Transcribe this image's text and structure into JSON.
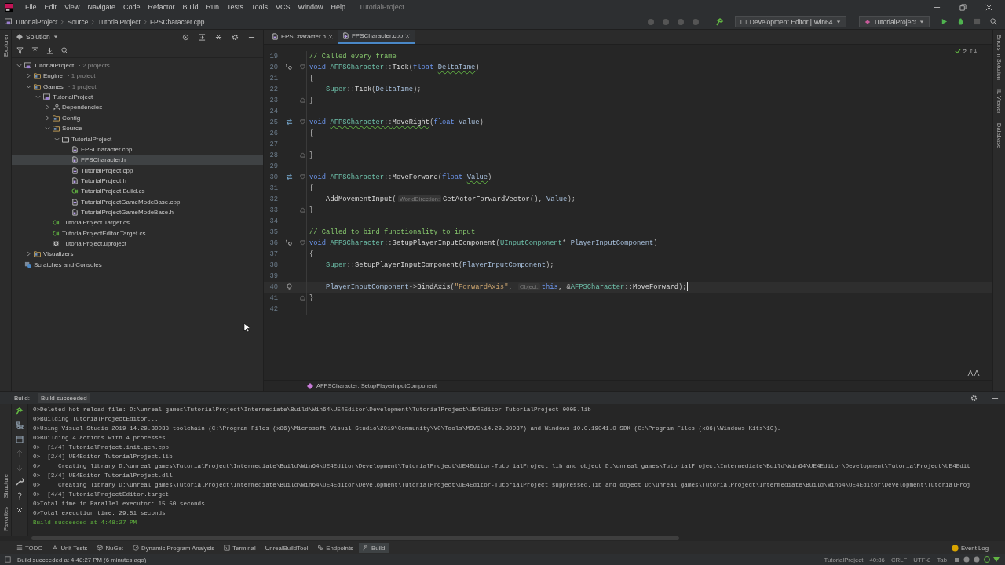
{
  "menu": {
    "items": [
      "File",
      "Edit",
      "View",
      "Navigate",
      "Code",
      "Refactor",
      "Build",
      "Run",
      "Tests",
      "Tools",
      "VCS",
      "Window",
      "Help"
    ],
    "title": "TutorialProject"
  },
  "breadcrumbs": [
    "TutorialProject",
    "Source",
    "TutorialProject",
    "FPSCharacter.cpp"
  ],
  "toolbar": {
    "configuration": "Development Editor | Win64",
    "run_target": "TutorialProject"
  },
  "left_strip": {
    "top_label": "Explorer",
    "bottom_labels": [
      "Structure",
      "Favorites"
    ]
  },
  "right_strip": {
    "labels": [
      "Errors In Solution",
      "IL Viewer",
      "Database"
    ]
  },
  "solution": {
    "header": "Solution",
    "tree": [
      {
        "label": "TutorialProject",
        "note": "· 2 projects",
        "kind": "solution",
        "expanded": true,
        "selected": false,
        "children": [
          {
            "label": "Engine",
            "note": "· 1 project",
            "kind": "ue-folder",
            "expanded": false,
            "selected": false
          },
          {
            "label": "Games",
            "note": "· 1 project",
            "kind": "ue-folder",
            "expanded": true,
            "selected": false,
            "children": [
              {
                "label": "TutorialProject",
                "kind": "project",
                "expanded": true,
                "selected": false,
                "children": [
                  {
                    "label": "Dependencies",
                    "kind": "deps",
                    "expanded": false,
                    "selected": false
                  },
                  {
                    "label": "Config",
                    "kind": "ue-folder",
                    "expanded": false,
                    "selected": false
                  },
                  {
                    "label": "Source",
                    "kind": "ue-folder",
                    "expanded": true,
                    "selected": false,
                    "children": [
                      {
                        "label": "TutorialProject",
                        "kind": "folder",
                        "expanded": true,
                        "selected": false,
                        "children": [
                          {
                            "label": "FPSCharacter.cpp",
                            "kind": "cpp",
                            "selected": false
                          },
                          {
                            "label": "FPSCharacter.h",
                            "kind": "h",
                            "selected": true
                          },
                          {
                            "label": "TutorialProject.cpp",
                            "kind": "cpp",
                            "selected": false
                          },
                          {
                            "label": "TutorialProject.h",
                            "kind": "h",
                            "selected": false
                          },
                          {
                            "label": "TutorialProject.Build.cs",
                            "kind": "cs",
                            "selected": false
                          },
                          {
                            "label": "TutorialProjectGameModeBase.cpp",
                            "kind": "cpp",
                            "selected": false
                          },
                          {
                            "label": "TutorialProjectGameModeBase.h",
                            "kind": "h",
                            "selected": false
                          }
                        ]
                      }
                    ]
                  },
                  {
                    "label": "TutorialProject.Target.cs",
                    "kind": "cs",
                    "selected": false
                  },
                  {
                    "label": "TutorialProjectEditor.Target.cs",
                    "kind": "cs",
                    "selected": false
                  },
                  {
                    "label": "TutorialProject.uproject",
                    "kind": "uproject",
                    "selected": false
                  }
                ]
              }
            ]
          },
          {
            "label": "Visualizers",
            "kind": "ue-folder",
            "expanded": false,
            "selected": false
          }
        ]
      },
      {
        "label": "Scratches and Consoles",
        "kind": "scratches",
        "selected": false
      }
    ]
  },
  "editor": {
    "tabs": [
      {
        "label": "FPSCharacter.h",
        "kind": "h",
        "selected": false
      },
      {
        "label": "FPSCharacter.cpp",
        "kind": "cpp",
        "selected": true
      }
    ],
    "inspection_count": "2",
    "lines": [
      {
        "number": "19",
        "current": false,
        "tokens": [
          {
            "kind": "comment",
            "text": "// Called every frame"
          }
        ]
      },
      {
        "number": "20",
        "current": false,
        "kind": "override",
        "fold_open": true,
        "tokens": [
          {
            "kind": "keyword",
            "text": "void "
          },
          {
            "kind": "type",
            "text": "AFPSCharacter"
          },
          {
            "kind": "plain",
            "text": "::"
          },
          {
            "kind": "func",
            "text": "Tick"
          },
          {
            "kind": "plain",
            "text": "("
          },
          {
            "kind": "keyword",
            "text": "float "
          },
          {
            "kind": "param",
            "text": "DeltaTime",
            "squiggle": true
          },
          {
            "kind": "plain",
            "text": ")"
          }
        ]
      },
      {
        "number": "21",
        "current": false,
        "tokens": [
          {
            "kind": "plain",
            "text": "{"
          }
        ]
      },
      {
        "number": "22",
        "current": false,
        "tokens": [
          {
            "kind": "type",
            "text": "    Super"
          },
          {
            "kind": "plain",
            "text": "::"
          },
          {
            "kind": "func",
            "text": "Tick"
          },
          {
            "kind": "plain",
            "text": "("
          },
          {
            "kind": "param",
            "text": "DeltaTime"
          },
          {
            "kind": "plain",
            "text": ");"
          }
        ]
      },
      {
        "number": "23",
        "current": false,
        "fold_close": true,
        "tokens": [
          {
            "kind": "plain",
            "text": "}"
          }
        ]
      },
      {
        "number": "24",
        "current": false
      },
      {
        "number": "25",
        "current": false,
        "kind": "swap",
        "fold_open": true,
        "tokens": [
          {
            "kind": "keyword",
            "text": "void "
          },
          {
            "kind": "type",
            "text": "AFPSCharacter",
            "squiggle": true
          },
          {
            "kind": "plain",
            "text": "::",
            "squiggle": true
          },
          {
            "kind": "func",
            "text": "MoveRight",
            "squiggle": true
          },
          {
            "kind": "plain",
            "text": "("
          },
          {
            "kind": "keyword",
            "text": "float "
          },
          {
            "kind": "param",
            "text": "Value"
          },
          {
            "kind": "plain",
            "text": ")"
          }
        ]
      },
      {
        "number": "26",
        "current": false,
        "tokens": [
          {
            "kind": "plain",
            "text": "{"
          }
        ]
      },
      {
        "number": "27",
        "current": false
      },
      {
        "number": "28",
        "current": false,
        "fold_close": true,
        "tokens": [
          {
            "kind": "plain",
            "text": "}"
          }
        ]
      },
      {
        "number": "29",
        "current": false
      },
      {
        "number": "30",
        "current": false,
        "kind": "swap",
        "fold_open": true,
        "tokens": [
          {
            "kind": "keyword",
            "text": "void "
          },
          {
            "kind": "type",
            "text": "AFPSCharacter"
          },
          {
            "kind": "plain",
            "text": "::"
          },
          {
            "kind": "func",
            "text": "MoveForward"
          },
          {
            "kind": "plain",
            "text": "("
          },
          {
            "kind": "keyword",
            "text": "float "
          },
          {
            "kind": "param",
            "text": "Value",
            "squiggle": true
          },
          {
            "kind": "plain",
            "text": ")"
          }
        ]
      },
      {
        "number": "31",
        "current": false,
        "tokens": [
          {
            "kind": "plain",
            "text": "{"
          }
        ]
      },
      {
        "number": "32",
        "current": false,
        "tokens": [
          {
            "kind": "func",
            "text": "    AddMovementInput"
          },
          {
            "kind": "plain",
            "text": "("
          },
          {
            "kind": "hint",
            "text": "WorldDirection:"
          },
          {
            "kind": "func",
            "text": "GetActorForwardVector"
          },
          {
            "kind": "plain",
            "text": "(), "
          },
          {
            "kind": "param",
            "text": "Value"
          },
          {
            "kind": "plain",
            "text": ");"
          }
        ]
      },
      {
        "number": "33",
        "current": false,
        "fold_close": true,
        "tokens": [
          {
            "kind": "plain",
            "text": "}"
          }
        ]
      },
      {
        "number": "34",
        "current": false
      },
      {
        "number": "35",
        "current": false,
        "tokens": [
          {
            "kind": "comment",
            "text": "// Called to bind functionality to input"
          }
        ]
      },
      {
        "number": "36",
        "current": false,
        "kind": "override",
        "fold_open": true,
        "tokens": [
          {
            "kind": "keyword",
            "text": "void "
          },
          {
            "kind": "type",
            "text": "AFPSCharacter"
          },
          {
            "kind": "plain",
            "text": "::"
          },
          {
            "kind": "func",
            "text": "SetupPlayerInputComponent"
          },
          {
            "kind": "plain",
            "text": "("
          },
          {
            "kind": "type",
            "text": "UInputComponent"
          },
          {
            "kind": "plain",
            "text": "* "
          },
          {
            "kind": "param",
            "text": "PlayerInputComponent"
          },
          {
            "kind": "plain",
            "text": ")"
          }
        ]
      },
      {
        "number": "37",
        "current": false,
        "tokens": [
          {
            "kind": "plain",
            "text": "{"
          }
        ]
      },
      {
        "number": "38",
        "current": false,
        "tokens": [
          {
            "kind": "type",
            "text": "    Super"
          },
          {
            "kind": "plain",
            "text": "::"
          },
          {
            "kind": "func",
            "text": "SetupPlayerInputComponent"
          },
          {
            "kind": "plain",
            "text": "("
          },
          {
            "kind": "param",
            "text": "PlayerInputComponent"
          },
          {
            "kind": "plain",
            "text": ");"
          }
        ]
      },
      {
        "number": "39",
        "current": false
      },
      {
        "number": "40",
        "current": true,
        "kind": "bulb",
        "tokens": [
          {
            "kind": "param",
            "text": "    PlayerInputComponent"
          },
          {
            "kind": "plain",
            "text": "->"
          },
          {
            "kind": "func",
            "text": "BindAxis"
          },
          {
            "kind": "plain",
            "text": "("
          },
          {
            "kind": "string",
            "text": "\"ForwardAxis\""
          },
          {
            "kind": "plain",
            "text": ", "
          },
          {
            "kind": "hint",
            "text": "Object:"
          },
          {
            "kind": "keyword",
            "text": "this"
          },
          {
            "kind": "plain",
            "text": ", &"
          },
          {
            "kind": "type",
            "text": "AFPSCharacter"
          },
          {
            "kind": "plain",
            "text": "::"
          },
          {
            "kind": "func",
            "text": "MoveForward"
          },
          {
            "kind": "plain",
            "text": ");"
          }
        ]
      },
      {
        "number": "41",
        "current": false,
        "fold_close": true,
        "tokens": [
          {
            "kind": "plain",
            "text": "}"
          }
        ]
      },
      {
        "number": "42",
        "current": false
      }
    ],
    "breadcrumb": "AFPSCharacter::SetupPlayerInputComponent"
  },
  "build": {
    "title": "Build:",
    "tab": "Build succeeded",
    "output": [
      {
        "kind": "log",
        "text": "0>Deleted hot-reload file: D:\\unreal games\\TutorialProject\\Intermediate\\Build\\Win64\\UE4Editor\\Development\\TutorialProject\\UE4Editor-TutorialProject-0005.lib"
      },
      {
        "kind": "log",
        "text": "0>Building TutorialProjectEditor..."
      },
      {
        "kind": "log",
        "text": "0>Using Visual Studio 2019 14.29.30038 toolchain (C:\\Program Files (x86)\\Microsoft Visual Studio\\2019\\Community\\VC\\Tools\\MSVC\\14.29.30037) and Windows 10.0.19041.0 SDK (C:\\Program Files (x86)\\Windows Kits\\10)."
      },
      {
        "kind": "log",
        "text": "0>Building 4 actions with 4 processes..."
      },
      {
        "kind": "log",
        "text": "0>  [1/4] TutorialProject.init.gen.cpp"
      },
      {
        "kind": "log",
        "text": "0>  [2/4] UE4Editor-TutorialProject.lib"
      },
      {
        "kind": "log",
        "text": "0>     Creating library D:\\unreal games\\TutorialProject\\Intermediate\\Build\\Win64\\UE4Editor\\Development\\TutorialProject\\UE4Editor-TutorialProject.lib and object D:\\unreal games\\TutorialProject\\Intermediate\\Build\\Win64\\UE4Editor\\Development\\TutorialProject\\UE4Edit"
      },
      {
        "kind": "log",
        "text": "0>  [3/4] UE4Editor-TutorialProject.dll"
      },
      {
        "kind": "log",
        "text": "0>     Creating library D:\\unreal games\\TutorialProject\\Intermediate\\Build\\Win64\\UE4Editor\\Development\\TutorialProject\\UE4Editor-TutorialProject.suppressed.lib and object D:\\unreal games\\TutorialProject\\Intermediate\\Build\\Win64\\UE4Editor\\Development\\TutorialProj"
      },
      {
        "kind": "log",
        "text": "0>  [4/4] TutorialProjectEditor.target"
      },
      {
        "kind": "log",
        "text": "0>Total time in Parallel executor: 15.50 seconds"
      },
      {
        "kind": "log",
        "text": "0>Total execution time: 29.51 seconds"
      },
      {
        "kind": "success",
        "text": "Build succeeded at 4:48:27 PM"
      }
    ]
  },
  "tool_tabs": [
    {
      "label": "TODO",
      "kind": "list",
      "selected": false
    },
    {
      "label": "Unit Tests",
      "kind": "test",
      "selected": false
    },
    {
      "label": "NuGet",
      "kind": "package",
      "selected": false
    },
    {
      "label": "Dynamic Program Analysis",
      "kind": "profiler",
      "selected": false
    },
    {
      "label": "Terminal",
      "kind": "terminal",
      "selected": false
    },
    {
      "label": "UnrealBuildTool",
      "kind": "none",
      "selected": false
    },
    {
      "label": "Endpoints",
      "kind": "endpoints",
      "selected": false
    },
    {
      "label": "Build",
      "kind": "hammer",
      "selected": true
    }
  ],
  "event_log": "Event Log",
  "status_bar": {
    "message": "Build succeeded at 4:48:27 PM (6 minutes ago)",
    "items": [
      "TutorialProject",
      "40:86",
      "CRLF",
      "UTF-8",
      "Tab"
    ]
  }
}
